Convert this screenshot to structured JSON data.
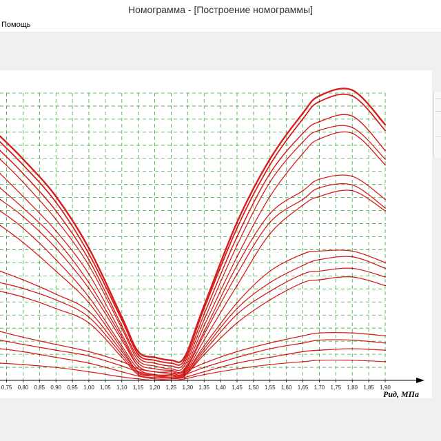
{
  "window": {
    "title": "Номограмма - [Построение номограммы]"
  },
  "menu": {
    "items": [
      {
        "label": "Помощь"
      }
    ]
  },
  "colors": {
    "curve": "#d81e1e",
    "grid": "#3aa83a",
    "axis": "#000000"
  },
  "chart_data": {
    "type": "line",
    "xlabel": "Pид, МПа",
    "ylabel": "",
    "xlim": [
      0.73,
      1.9
    ],
    "ylim": [
      0,
      100
    ],
    "x_ticks": [
      "0,75",
      "0,80",
      "0,85",
      "0,90",
      "0,95",
      "1,00",
      "1,05",
      "1,10",
      "1,15",
      "1,20",
      "1,25",
      "1,30",
      "1,35",
      "1,40",
      "1,45",
      "1,50",
      "1,55",
      "1,60",
      "1,65",
      "1,70",
      "1,75",
      "1,80",
      "1,85",
      "1,90"
    ],
    "grid": true,
    "series": [
      {
        "width": 2.4,
        "points": [
          [
            0.73,
            85
          ],
          [
            0.8,
            77
          ],
          [
            0.9,
            64
          ],
          [
            1.0,
            46
          ],
          [
            1.1,
            22
          ],
          [
            1.15,
            10
          ],
          [
            1.2,
            8
          ],
          [
            1.25,
            7
          ],
          [
            1.29,
            8
          ],
          [
            1.35,
            26
          ],
          [
            1.45,
            55
          ],
          [
            1.55,
            77
          ],
          [
            1.65,
            93
          ],
          [
            1.7,
            99
          ],
          [
            1.8,
            101
          ],
          [
            1.9,
            89
          ]
        ]
      },
      {
        "width": 1.8,
        "points": [
          [
            0.73,
            83
          ],
          [
            0.8,
            75
          ],
          [
            0.9,
            62
          ],
          [
            1.0,
            44
          ],
          [
            1.1,
            21
          ],
          [
            1.15,
            9
          ],
          [
            1.2,
            7
          ],
          [
            1.25,
            6
          ],
          [
            1.29,
            7
          ],
          [
            1.35,
            25
          ],
          [
            1.45,
            53
          ],
          [
            1.55,
            75
          ],
          [
            1.65,
            91
          ],
          [
            1.7,
            97
          ],
          [
            1.8,
            99
          ],
          [
            1.9,
            87
          ]
        ]
      },
      {
        "width": 1.5,
        "points": [
          [
            0.73,
            80
          ],
          [
            0.8,
            72
          ],
          [
            0.9,
            59
          ],
          [
            1.0,
            42
          ],
          [
            1.1,
            19
          ],
          [
            1.15,
            8
          ],
          [
            1.2,
            6
          ],
          [
            1.25,
            5
          ],
          [
            1.29,
            6
          ],
          [
            1.35,
            23
          ],
          [
            1.45,
            50
          ],
          [
            1.55,
            72
          ],
          [
            1.65,
            86
          ],
          [
            1.7,
            90
          ],
          [
            1.8,
            92
          ],
          [
            1.9,
            80
          ]
        ]
      },
      {
        "width": 1.3,
        "points": [
          [
            0.73,
            77
          ],
          [
            0.8,
            69
          ],
          [
            0.9,
            56
          ],
          [
            1.0,
            40
          ],
          [
            1.1,
            18
          ],
          [
            1.15,
            7
          ],
          [
            1.2,
            5
          ],
          [
            1.25,
            4
          ],
          [
            1.29,
            5
          ],
          [
            1.35,
            21
          ],
          [
            1.45,
            47
          ],
          [
            1.55,
            69
          ],
          [
            1.65,
            83
          ],
          [
            1.7,
            87
          ],
          [
            1.8,
            88
          ],
          [
            1.9,
            77
          ]
        ]
      },
      {
        "width": 1.3,
        "points": [
          [
            0.73,
            72
          ],
          [
            0.8,
            64
          ],
          [
            0.9,
            52
          ],
          [
            1.0,
            37
          ],
          [
            1.1,
            16
          ],
          [
            1.15,
            6
          ],
          [
            1.2,
            4
          ],
          [
            1.25,
            3.5
          ],
          [
            1.29,
            4
          ],
          [
            1.35,
            19
          ],
          [
            1.45,
            43
          ],
          [
            1.55,
            64
          ],
          [
            1.65,
            79
          ],
          [
            1.7,
            84
          ],
          [
            1.8,
            86
          ],
          [
            1.9,
            75
          ]
        ]
      },
      {
        "width": 1.3,
        "points": [
          [
            0.73,
            67
          ],
          [
            0.8,
            60
          ],
          [
            0.9,
            49
          ],
          [
            1.0,
            34
          ],
          [
            1.1,
            15
          ],
          [
            1.15,
            5
          ],
          [
            1.2,
            3
          ],
          [
            1.25,
            3
          ],
          [
            1.29,
            3.5
          ],
          [
            1.35,
            17
          ],
          [
            1.45,
            40
          ],
          [
            1.55,
            58
          ],
          [
            1.65,
            66
          ],
          [
            1.7,
            70
          ],
          [
            1.8,
            71
          ],
          [
            1.9,
            63
          ]
        ]
      },
      {
        "width": 1.3,
        "points": [
          [
            0.73,
            63
          ],
          [
            0.8,
            57
          ],
          [
            0.9,
            46
          ],
          [
            1.0,
            32
          ],
          [
            1.1,
            14
          ],
          [
            1.15,
            5
          ],
          [
            1.2,
            3
          ],
          [
            1.25,
            2.5
          ],
          [
            1.29,
            3
          ],
          [
            1.35,
            16
          ],
          [
            1.45,
            37
          ],
          [
            1.55,
            55
          ],
          [
            1.65,
            63
          ],
          [
            1.7,
            67
          ],
          [
            1.8,
            68
          ],
          [
            1.9,
            60
          ]
        ]
      },
      {
        "width": 1.3,
        "points": [
          [
            0.73,
            59
          ],
          [
            0.8,
            53
          ],
          [
            0.9,
            42
          ],
          [
            1.0,
            29
          ],
          [
            1.1,
            12
          ],
          [
            1.15,
            4
          ],
          [
            1.2,
            2
          ],
          [
            1.25,
            2
          ],
          [
            1.29,
            2.5
          ],
          [
            1.35,
            14
          ],
          [
            1.45,
            33
          ],
          [
            1.55,
            51
          ],
          [
            1.65,
            61
          ],
          [
            1.7,
            64
          ],
          [
            1.8,
            66
          ],
          [
            1.9,
            59
          ]
        ]
      },
      {
        "width": 1.3,
        "points": [
          [
            0.73,
            54
          ],
          [
            0.8,
            48
          ],
          [
            0.9,
            38
          ],
          [
            1.0,
            27
          ],
          [
            1.1,
            11
          ],
          [
            1.15,
            3
          ],
          [
            1.2,
            2
          ],
          [
            1.25,
            1.5
          ],
          [
            1.29,
            2
          ],
          [
            1.35,
            12
          ],
          [
            1.45,
            27
          ],
          [
            1.55,
            38
          ],
          [
            1.65,
            44
          ],
          [
            1.7,
            45
          ],
          [
            1.8,
            45
          ],
          [
            1.9,
            41
          ]
        ]
      },
      {
        "width": 1.3,
        "points": [
          [
            0.73,
            38
          ],
          [
            0.8,
            35
          ],
          [
            0.9,
            30
          ],
          [
            1.0,
            24
          ],
          [
            1.1,
            10
          ],
          [
            1.15,
            3
          ],
          [
            1.2,
            1.5
          ],
          [
            1.25,
            1.5
          ],
          [
            1.29,
            2
          ],
          [
            1.35,
            11
          ],
          [
            1.45,
            25
          ],
          [
            1.55,
            34
          ],
          [
            1.65,
            40
          ],
          [
            1.7,
            42
          ],
          [
            1.8,
            43
          ],
          [
            1.9,
            39
          ]
        ]
      },
      {
        "width": 1.3,
        "points": [
          [
            0.73,
            34
          ],
          [
            0.8,
            32
          ],
          [
            0.9,
            28
          ],
          [
            1.0,
            22
          ],
          [
            1.1,
            9
          ],
          [
            1.15,
            2.5
          ],
          [
            1.2,
            1.5
          ],
          [
            1.25,
            1
          ],
          [
            1.29,
            1.5
          ],
          [
            1.35,
            10
          ],
          [
            1.45,
            23
          ],
          [
            1.55,
            31
          ],
          [
            1.65,
            37
          ],
          [
            1.7,
            38
          ],
          [
            1.8,
            39
          ],
          [
            1.9,
            36
          ]
        ]
      },
      {
        "width": 1.3,
        "points": [
          [
            0.73,
            31
          ],
          [
            0.8,
            29
          ],
          [
            0.9,
            25
          ],
          [
            1.0,
            20
          ],
          [
            1.1,
            8
          ],
          [
            1.15,
            2
          ],
          [
            1.2,
            1
          ],
          [
            1.25,
            1
          ],
          [
            1.29,
            1.5
          ],
          [
            1.35,
            9
          ],
          [
            1.45,
            20
          ],
          [
            1.55,
            28
          ],
          [
            1.65,
            34
          ],
          [
            1.7,
            35
          ],
          [
            1.8,
            36
          ],
          [
            1.9,
            33
          ]
        ]
      },
      {
        "width": 1.3,
        "points": [
          [
            0.73,
            17
          ],
          [
            0.8,
            15
          ],
          [
            0.9,
            12.5
          ],
          [
            1.0,
            10
          ],
          [
            1.1,
            6.5
          ],
          [
            1.15,
            4
          ],
          [
            1.2,
            3
          ],
          [
            1.25,
            2.5
          ],
          [
            1.29,
            3
          ],
          [
            1.35,
            6
          ],
          [
            1.45,
            10
          ],
          [
            1.55,
            13
          ],
          [
            1.65,
            15.5
          ],
          [
            1.7,
            16.5
          ],
          [
            1.8,
            16.5
          ],
          [
            1.9,
            15.5
          ]
        ]
      },
      {
        "width": 1.3,
        "points": [
          [
            0.73,
            14
          ],
          [
            0.8,
            12.5
          ],
          [
            0.9,
            10.5
          ],
          [
            1.0,
            8.5
          ],
          [
            1.1,
            5
          ],
          [
            1.15,
            3
          ],
          [
            1.2,
            2
          ],
          [
            1.25,
            1.5
          ],
          [
            1.29,
            2
          ],
          [
            1.35,
            4.5
          ],
          [
            1.45,
            8
          ],
          [
            1.55,
            11
          ],
          [
            1.65,
            13
          ],
          [
            1.7,
            14
          ],
          [
            1.8,
            14
          ],
          [
            1.9,
            13
          ]
        ]
      },
      {
        "width": 1.3,
        "points": [
          [
            0.73,
            11
          ],
          [
            0.8,
            10
          ],
          [
            0.9,
            8
          ],
          [
            1.0,
            6
          ],
          [
            1.1,
            3
          ],
          [
            1.15,
            1.5
          ],
          [
            1.2,
            0.5
          ],
          [
            1.25,
            0.5
          ],
          [
            1.29,
            1
          ],
          [
            1.35,
            3
          ],
          [
            1.45,
            6
          ],
          [
            1.55,
            8
          ],
          [
            1.65,
            10
          ],
          [
            1.7,
            10.5
          ],
          [
            1.8,
            11
          ],
          [
            1.9,
            10.5
          ]
        ]
      },
      {
        "width": 1.2,
        "points": [
          [
            0.73,
            6
          ],
          [
            0.8,
            5.5
          ],
          [
            0.9,
            4.5
          ],
          [
            1.0,
            3
          ],
          [
            1.1,
            1.2
          ],
          [
            1.15,
            0.5
          ],
          [
            1.2,
            0
          ],
          [
            1.25,
            0
          ],
          [
            1.29,
            0.5
          ],
          [
            1.35,
            2
          ],
          [
            1.45,
            4
          ],
          [
            1.55,
            5.5
          ],
          [
            1.65,
            6.5
          ],
          [
            1.7,
            7
          ],
          [
            1.8,
            7
          ],
          [
            1.9,
            6.5
          ]
        ]
      }
    ]
  }
}
